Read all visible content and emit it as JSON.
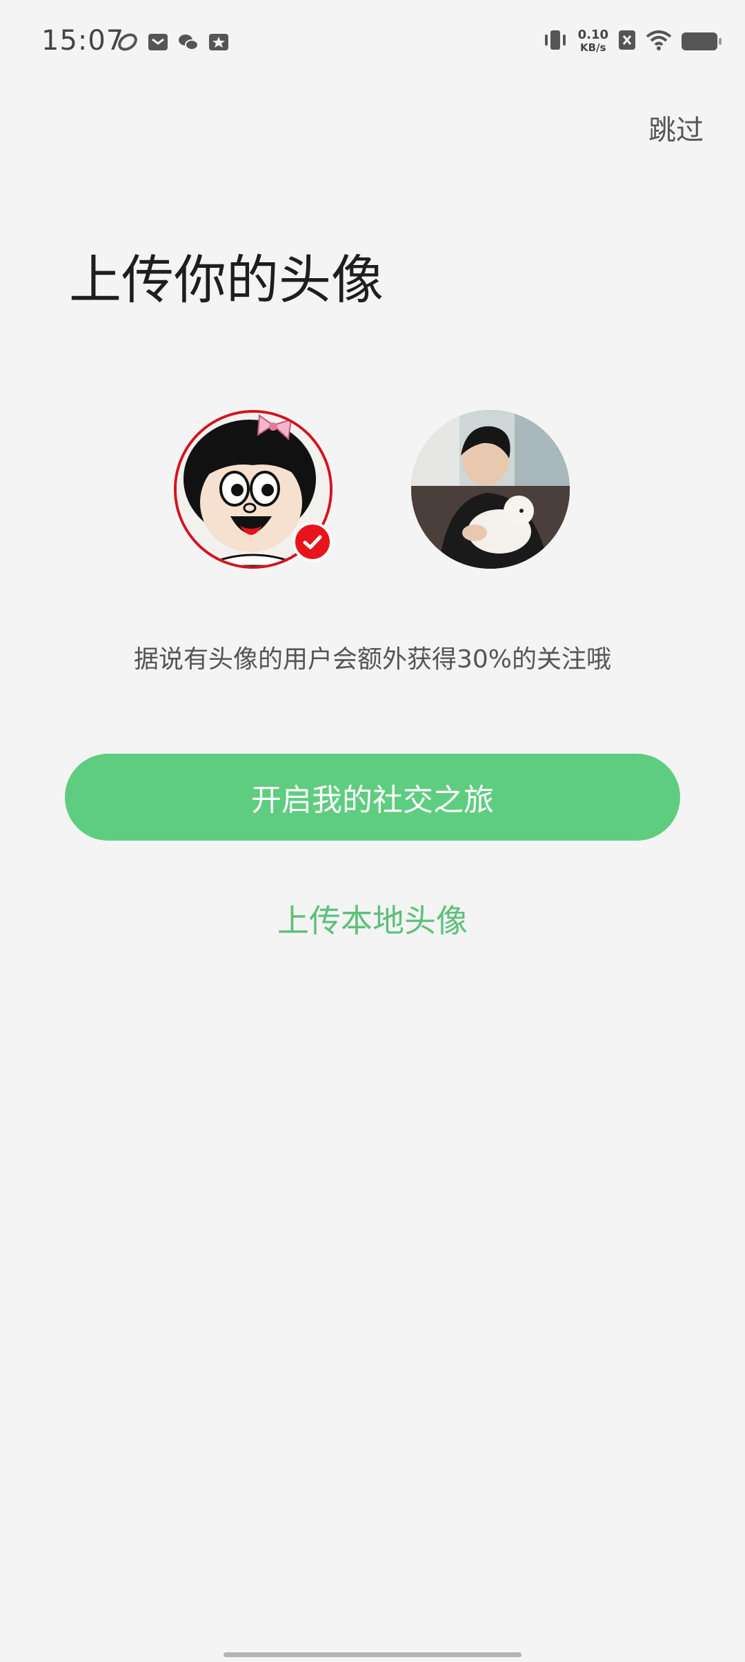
{
  "status_bar": {
    "time": "15:07",
    "net_speed_value": "0.10",
    "net_speed_unit": "KB/s",
    "icons": [
      "app-icon",
      "mail-icon",
      "wechat-icon",
      "star-icon",
      "vibrate-icon",
      "sim-off-icon",
      "wifi-icon",
      "battery-icon"
    ]
  },
  "header": {
    "skip_label": "跳过"
  },
  "main": {
    "title": "上传你的头像",
    "hint": "据说有头像的用户会额外获得30%的关注哦",
    "primary_button": "开启我的社交之旅",
    "upload_link": "上传本地头像",
    "avatars": [
      {
        "name": "avatar-cartoon",
        "selected": true
      },
      {
        "name": "avatar-photo",
        "selected": false
      }
    ]
  },
  "colors": {
    "accent_green": "#5fcd80",
    "link_green": "#5cc07a",
    "selected_red": "#d2141e",
    "background": "#f4f4f4"
  }
}
